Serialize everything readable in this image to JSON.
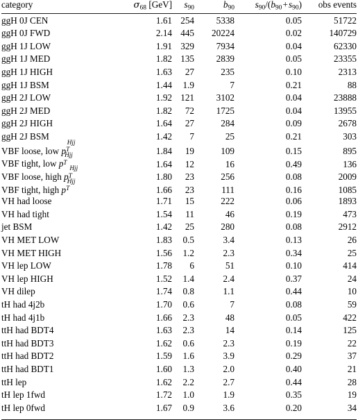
{
  "table": {
    "columns": [
      {
        "key": "category",
        "label": "category",
        "align": "left"
      },
      {
        "key": "sigma68",
        "label": "σ68 [GeV]",
        "align": "right"
      },
      {
        "key": "s90",
        "label": "s90",
        "align": "right"
      },
      {
        "key": "b90",
        "label": "b90",
        "align": "right"
      },
      {
        "key": "purity",
        "label": "s90/(b90 + s90)",
        "align": "right"
      },
      {
        "key": "obs",
        "label": "obs events",
        "align": "right"
      }
    ],
    "header": {
      "category": "category",
      "sigma_symbol": "σ",
      "sigma_sub": "68",
      "sigma_unit": "[GeV]",
      "s_symbol": "s",
      "s_sub": "90",
      "b_symbol": "b",
      "b_sub": "90",
      "purity_slash": "/",
      "purity_open": "(",
      "purity_plus": "+",
      "purity_close": ")",
      "obs_events": "obs events"
    },
    "rows": [
      {
        "category": "ggH 0J CEN",
        "sigma68": "1.61",
        "s90": "254",
        "b90": "5338",
        "purity": "0.05",
        "obs": "51722"
      },
      {
        "category": "ggH 0J FWD",
        "sigma68": "2.14",
        "s90": "445",
        "b90": "20224",
        "purity": "0.02",
        "obs": "140729"
      },
      {
        "category": "ggH 1J LOW",
        "sigma68": "1.91",
        "s90": "329",
        "b90": "7934",
        "purity": "0.04",
        "obs": "62330"
      },
      {
        "category": "ggH 1J MED",
        "sigma68": "1.82",
        "s90": "135",
        "b90": "2839",
        "purity": "0.05",
        "obs": "23355"
      },
      {
        "category": "ggH 1J HIGH",
        "sigma68": "1.63",
        "s90": "27",
        "b90": "235",
        "purity": "0.10",
        "obs": "2313"
      },
      {
        "category": "ggH 1J BSM",
        "sigma68": "1.44",
        "s90": "1.9",
        "b90": "7",
        "purity": "0.21",
        "obs": "88"
      },
      {
        "category": "ggH 2J LOW",
        "sigma68": "1.92",
        "s90": "121",
        "b90": "3102",
        "purity": "0.04",
        "obs": "23888"
      },
      {
        "category": "ggH 2J MED",
        "sigma68": "1.82",
        "s90": "72",
        "b90": "1725",
        "purity": "0.04",
        "obs": "13955"
      },
      {
        "category": "ggH 2J HIGH",
        "sigma68": "1.64",
        "s90": "27",
        "b90": "284",
        "purity": "0.09",
        "obs": "2678"
      },
      {
        "category": "ggH 2J BSM",
        "sigma68": "1.42",
        "s90": "7",
        "b90": "25",
        "purity": "0.21",
        "obs": "303"
      },
      {
        "category": "VBF loose, low pT^Hjj",
        "category_prefix": "VBF loose, low ",
        "pt": true,
        "sigma68": "1.84",
        "s90": "19",
        "b90": "109",
        "purity": "0.15",
        "obs": "895"
      },
      {
        "category": "VBF tight, low pT^Hjj",
        "category_prefix": "VBF tight, low ",
        "pt": true,
        "sigma68": "1.64",
        "s90": "12",
        "b90": "16",
        "purity": "0.49",
        "obs": "136"
      },
      {
        "category": "VBF loose, high pT^Hjj",
        "category_prefix": "VBF loose, high ",
        "pt": true,
        "sigma68": "1.80",
        "s90": "23",
        "b90": "256",
        "purity": "0.08",
        "obs": "2009"
      },
      {
        "category": "VBF tight, high pT^Hjj",
        "category_prefix": "VBF tight, high ",
        "pt": true,
        "sigma68": "1.66",
        "s90": "23",
        "b90": "111",
        "purity": "0.16",
        "obs": "1085"
      },
      {
        "category": "VH had loose",
        "sigma68": "1.71",
        "s90": "15",
        "b90": "222",
        "purity": "0.06",
        "obs": "1893"
      },
      {
        "category": "VH had tight",
        "sigma68": "1.54",
        "s90": "11",
        "b90": "46",
        "purity": "0.19",
        "obs": "473"
      },
      {
        "category": "jet BSM",
        "sigma68": "1.42",
        "s90": "25",
        "b90": "280",
        "purity": "0.08",
        "obs": "2912"
      },
      {
        "category": "VH MET LOW",
        "sigma68": "1.83",
        "s90": "0.5",
        "b90": "3.4",
        "purity": "0.13",
        "obs": "26"
      },
      {
        "category": "VH MET HIGH",
        "sigma68": "1.56",
        "s90": "1.2",
        "b90": "2.3",
        "purity": "0.34",
        "obs": "25"
      },
      {
        "category": "VH lep LOW",
        "sigma68": "1.78",
        "s90": "6",
        "b90": "51",
        "purity": "0.10",
        "obs": "414"
      },
      {
        "category": "VH lep HIGH",
        "sigma68": "1.52",
        "s90": "1.4",
        "b90": "2.4",
        "purity": "0.37",
        "obs": "24"
      },
      {
        "category": "VH dilep",
        "sigma68": "1.74",
        "s90": "0.8",
        "b90": "1.1",
        "purity": "0.44",
        "obs": "10"
      },
      {
        "category": "tH had 4j2b",
        "sigma68": "1.70",
        "s90": "0.6",
        "b90": "7",
        "purity": "0.08",
        "obs": "59"
      },
      {
        "category": "tH had 4j1b",
        "sigma68": "1.66",
        "s90": "2.3",
        "b90": "48",
        "purity": "0.05",
        "obs": "422"
      },
      {
        "category": "ttH had BDT4",
        "sigma68": "1.63",
        "s90": "2.3",
        "b90": "14",
        "purity": "0.14",
        "obs": "125"
      },
      {
        "category": "ttH had BDT3",
        "sigma68": "1.62",
        "s90": "0.6",
        "b90": "2.3",
        "purity": "0.19",
        "obs": "22"
      },
      {
        "category": "ttH had BDT2",
        "sigma68": "1.59",
        "s90": "1.6",
        "b90": "3.9",
        "purity": "0.29",
        "obs": "37"
      },
      {
        "category": "ttH had BDT1",
        "sigma68": "1.60",
        "s90": "1.3",
        "b90": "2.0",
        "purity": "0.40",
        "obs": "21"
      },
      {
        "category": "ttH lep",
        "sigma68": "1.62",
        "s90": "2.2",
        "b90": "2.7",
        "purity": "0.44",
        "obs": "28"
      },
      {
        "category": "tH lep 1fwd",
        "sigma68": "1.72",
        "s90": "1.0",
        "b90": "1.9",
        "purity": "0.35",
        "obs": "19"
      },
      {
        "category": "tH lep 0fwd",
        "sigma68": "1.67",
        "s90": "0.9",
        "b90": "3.6",
        "purity": "0.20",
        "obs": "34"
      }
    ],
    "pt_label": {
      "base": "p",
      "sub": "T",
      "sup": "Hjj"
    }
  },
  "colors": {
    "text": "#000000",
    "rule": "#1a1a1a",
    "background": "#ffffff"
  }
}
